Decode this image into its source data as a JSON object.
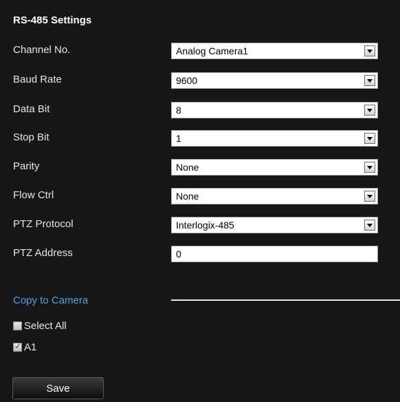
{
  "section_title": "RS-485 Settings",
  "fields": {
    "channel_no": {
      "label": "Channel No.",
      "value": "Analog Camera1"
    },
    "baud_rate": {
      "label": "Baud Rate",
      "value": "9600"
    },
    "data_bit": {
      "label": "Data Bit",
      "value": "8"
    },
    "stop_bit": {
      "label": "Stop Bit",
      "value": "1"
    },
    "parity": {
      "label": "Parity",
      "value": "None"
    },
    "flow_ctrl": {
      "label": "Flow Ctrl",
      "value": "None"
    },
    "ptz_protocol": {
      "label": "PTZ Protocol",
      "value": "Interlogix-485"
    },
    "ptz_address": {
      "label": "PTZ Address",
      "value": "0"
    }
  },
  "copy": {
    "label": "Copy to Camera",
    "select_all": {
      "label": "Select All",
      "checked": false
    },
    "cameras": [
      {
        "label": "A1",
        "checked": true
      }
    ]
  },
  "save_label": "Save",
  "colors": {
    "background": "#161616",
    "link": "#4aa3e6"
  }
}
